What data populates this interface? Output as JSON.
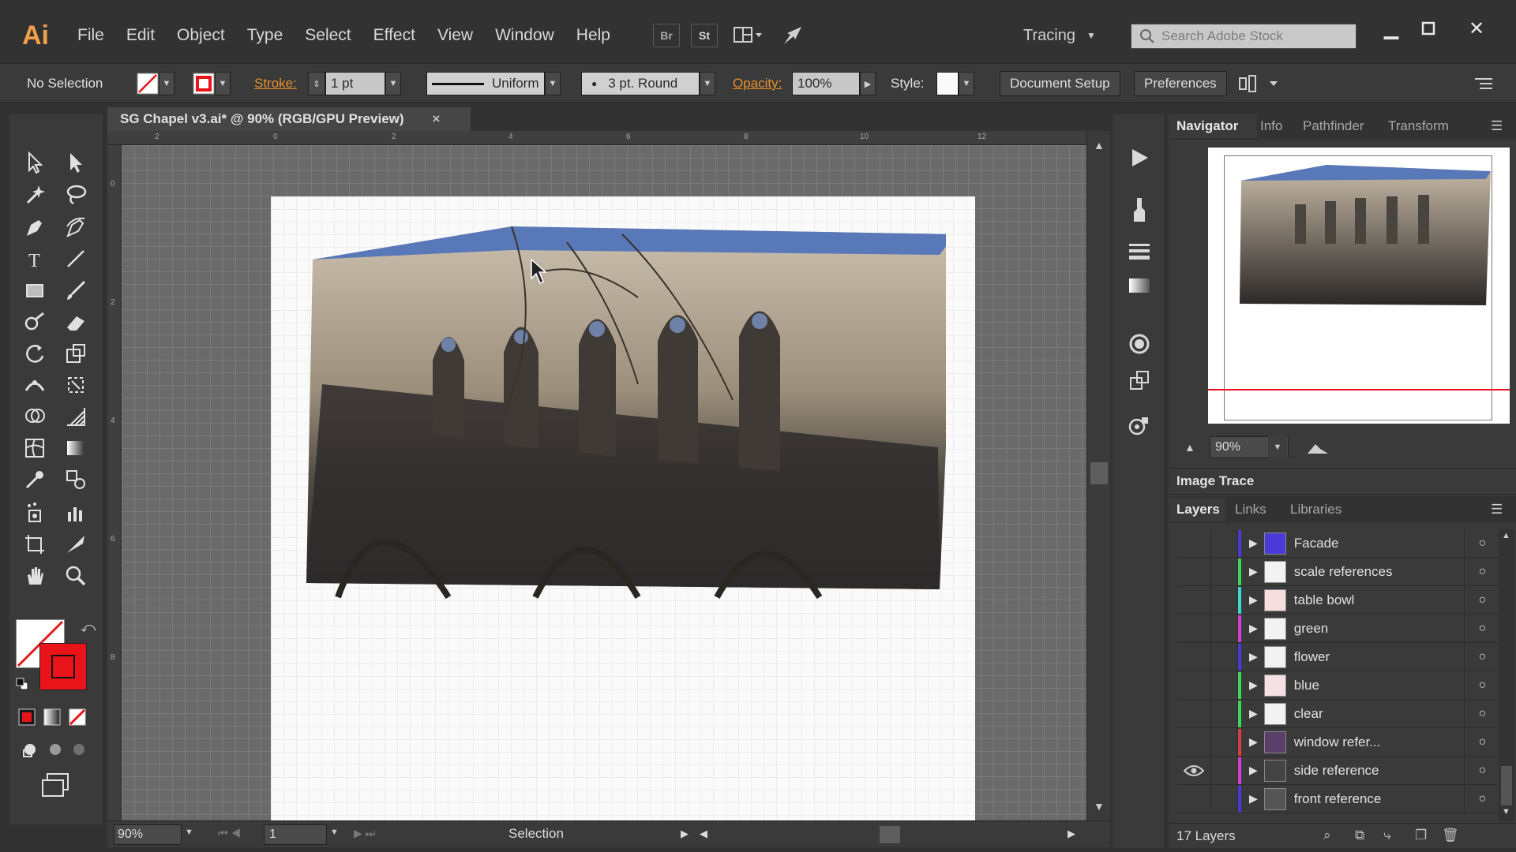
{
  "app": {
    "logo": "Ai"
  },
  "menu": [
    "File",
    "Edit",
    "Object",
    "Type",
    "Select",
    "Effect",
    "View",
    "Window",
    "Help"
  ],
  "topbar": {
    "bridge": "Br",
    "stock": "St",
    "workspace": "Tracing",
    "search_placeholder": "Search Adobe Stock"
  },
  "control": {
    "selection": "No Selection",
    "stroke_label": "Stroke:",
    "stroke_weight": "1 pt",
    "profile": "Uniform",
    "brush": "3 pt. Round",
    "opacity_label": "Opacity:",
    "opacity_value": "100%",
    "style_label": "Style:",
    "document_setup": "Document Setup",
    "preferences": "Preferences"
  },
  "document": {
    "tab_title": "SG Chapel v3.ai* @ 90% (RGB/GPU Preview)",
    "close": "×"
  },
  "rulers": {
    "top": [
      "2",
      "0",
      "2",
      "4",
      "6",
      "8",
      "10",
      "12"
    ],
    "left": [
      "0",
      "2",
      "4",
      "6",
      "8"
    ]
  },
  "status": {
    "zoom": "90%",
    "artboard": "1",
    "tool": "Selection"
  },
  "navigator": {
    "tabs": [
      "Navigator",
      "Info",
      "Pathfinder",
      "Transform"
    ],
    "zoom": "90%"
  },
  "image_trace": {
    "title": "Image Trace"
  },
  "layers_panel": {
    "tabs": [
      "Layers",
      "Links",
      "Libraries"
    ],
    "count": "17 Layers",
    "layers": [
      {
        "name": "Facade",
        "color": "#4a3bd9",
        "visible": false
      },
      {
        "name": "scale references",
        "color": "#3fd45a",
        "visible": false
      },
      {
        "name": "table bowl",
        "color": "#3fd6d6",
        "visible": false
      },
      {
        "name": "green",
        "color": "#d63fd6",
        "visible": false
      },
      {
        "name": "flower",
        "color": "#4a3bd9",
        "visible": false
      },
      {
        "name": "blue",
        "color": "#3fd45a",
        "visible": false
      },
      {
        "name": "clear",
        "color": "#3fd45a",
        "visible": false
      },
      {
        "name": "window refer...",
        "color": "#d63f3f",
        "visible": false
      },
      {
        "name": "side reference",
        "color": "#d63fd6",
        "visible": true
      },
      {
        "name": "front reference",
        "color": "#4a3bd9",
        "visible": false
      }
    ]
  },
  "colors": {
    "accent_orange": "#e88f2a",
    "stroke_red": "#e8141a"
  }
}
